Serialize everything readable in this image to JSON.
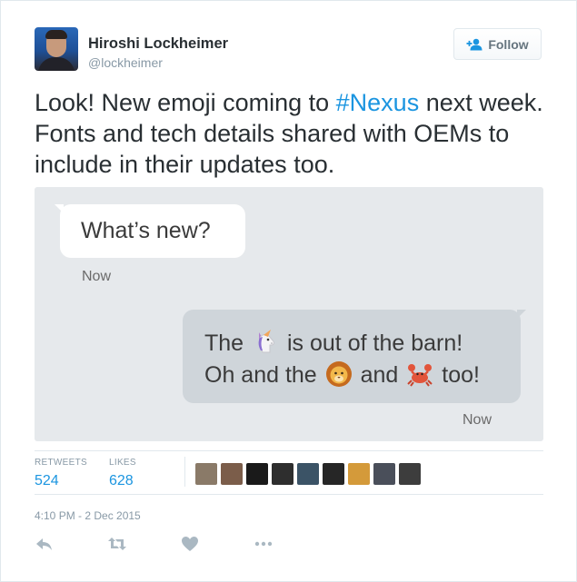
{
  "author": {
    "name": "Hiroshi Lockheimer",
    "handle": "@lockheimer"
  },
  "follow_button": {
    "label": "Follow",
    "icon": "add-user-icon"
  },
  "tweet": {
    "text_before": "Look! New emoji coming to ",
    "hashtag": "#Nexus",
    "text_after": " next week. Fonts and tech details shared with OEMs to include in their updates too."
  },
  "media": {
    "incoming": {
      "text": "What’s new?",
      "time": "Now"
    },
    "outgoing": {
      "line1_part1": "The",
      "line1_part2": "is out of the barn!",
      "line2_part1": "Oh and the",
      "line2_part2": "and",
      "line2_part3": "too!",
      "time": "Now",
      "emoji": [
        "unicorn",
        "lion",
        "crab"
      ]
    }
  },
  "stats": {
    "retweets_label": "RETWEETS",
    "retweets_value": "524",
    "likes_label": "LIKES",
    "likes_value": "628"
  },
  "liker_avatars": [
    "#8a7a68",
    "#7b5d4a",
    "#1a1a1a",
    "#2e2e2e",
    "#3b5366",
    "#262626",
    "#d49a3a",
    "#4a4f5a",
    "#3d3d3d"
  ],
  "timestamp": "4:10 PM - 2 Dec 2015",
  "actions": [
    "reply-icon",
    "retweet-icon",
    "like-icon",
    "more-icon"
  ],
  "colors": {
    "accent": "#1b95e0",
    "muted": "#8899a6",
    "text": "#292f33"
  }
}
